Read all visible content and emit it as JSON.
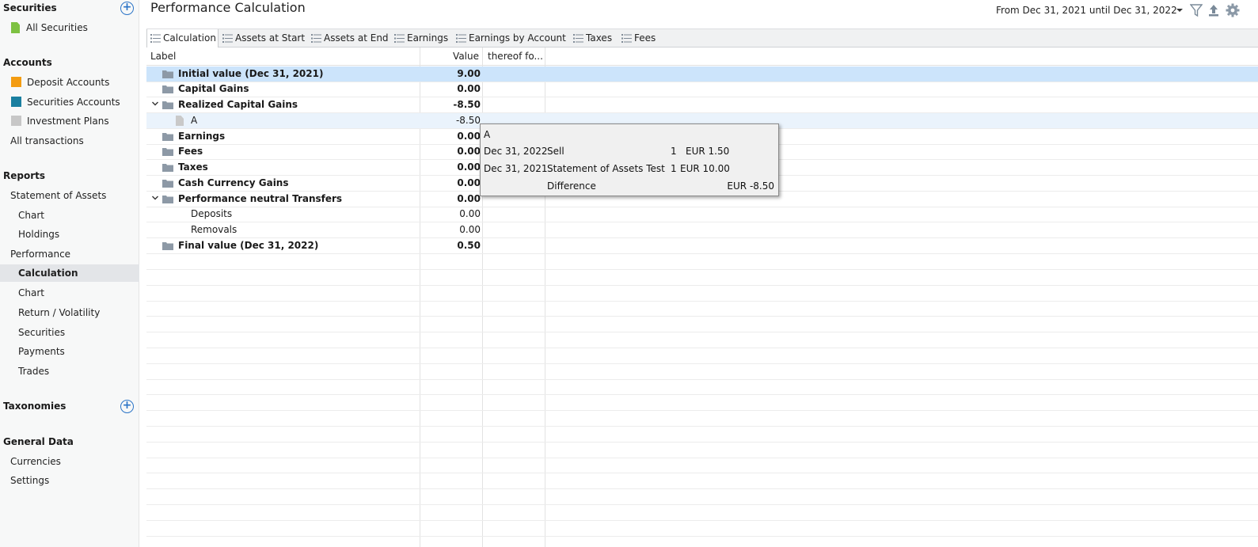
{
  "sidebar": {
    "securities": {
      "title": "Securities",
      "items": [
        "All Securities"
      ]
    },
    "accounts": {
      "title": "Accounts",
      "items": [
        "Deposit Accounts",
        "Securities Accounts",
        "Investment Plans",
        "All transactions"
      ]
    },
    "reports": {
      "title": "Reports",
      "items": [
        "Statement of Assets",
        "Chart",
        "Holdings",
        "Performance",
        "Calculation",
        "Chart",
        "Return / Volatility",
        "Securities",
        "Payments",
        "Trades"
      ]
    },
    "taxonomies": {
      "title": "Taxonomies"
    },
    "general": {
      "title": "General Data",
      "items": [
        "Currencies",
        "Settings"
      ]
    }
  },
  "header": {
    "title": "Performance Calculation",
    "period": "From Dec 31, 2021 until Dec 31, 2022"
  },
  "tabs": [
    "Calculation",
    "Assets at Start",
    "Assets at End",
    "Earnings",
    "Earnings by Account",
    "Taxes",
    "Fees"
  ],
  "table": {
    "columns": [
      "Label",
      "Value",
      "thereof fo..."
    ],
    "rows": [
      {
        "label": "Initial value (Dec 31, 2021)",
        "value": "9.00"
      },
      {
        "label": "Capital Gains",
        "value": "0.00"
      },
      {
        "label": "Realized Capital Gains",
        "value": "-8.50"
      },
      {
        "label": "A",
        "value": "-8.50"
      },
      {
        "label": "Earnings",
        "value": "0.00"
      },
      {
        "label": "Fees",
        "value": "0.00"
      },
      {
        "label": "Taxes",
        "value": "0.00"
      },
      {
        "label": "Cash Currency Gains",
        "value": "0.00"
      },
      {
        "label": "Performance neutral Transfers",
        "value": "0.00"
      },
      {
        "label": "Deposits",
        "value": "0.00"
      },
      {
        "label": "Removals",
        "value": "0.00"
      },
      {
        "label": "Final value (Dec 31, 2022)",
        "value": "0.50"
      }
    ]
  },
  "tooltip": {
    "title": "A",
    "rows": [
      {
        "date": "Dec 31, 2022",
        "desc": "Sell",
        "qty": "1",
        "amount": "EUR 1.50"
      },
      {
        "date": "Dec 31, 2021",
        "desc": "Statement of Assets Test S",
        "qty": "1",
        "amount": "EUR 10.00"
      }
    ],
    "diff_label": "Difference",
    "diff_value": "EUR -8.50"
  },
  "colors": {
    "accent": "#2b74c7",
    "selected_row": "#cce4fb",
    "deposit": "#f39c12",
    "securities_acct": "#1a7fa0",
    "plans": "#c7c7c7"
  }
}
